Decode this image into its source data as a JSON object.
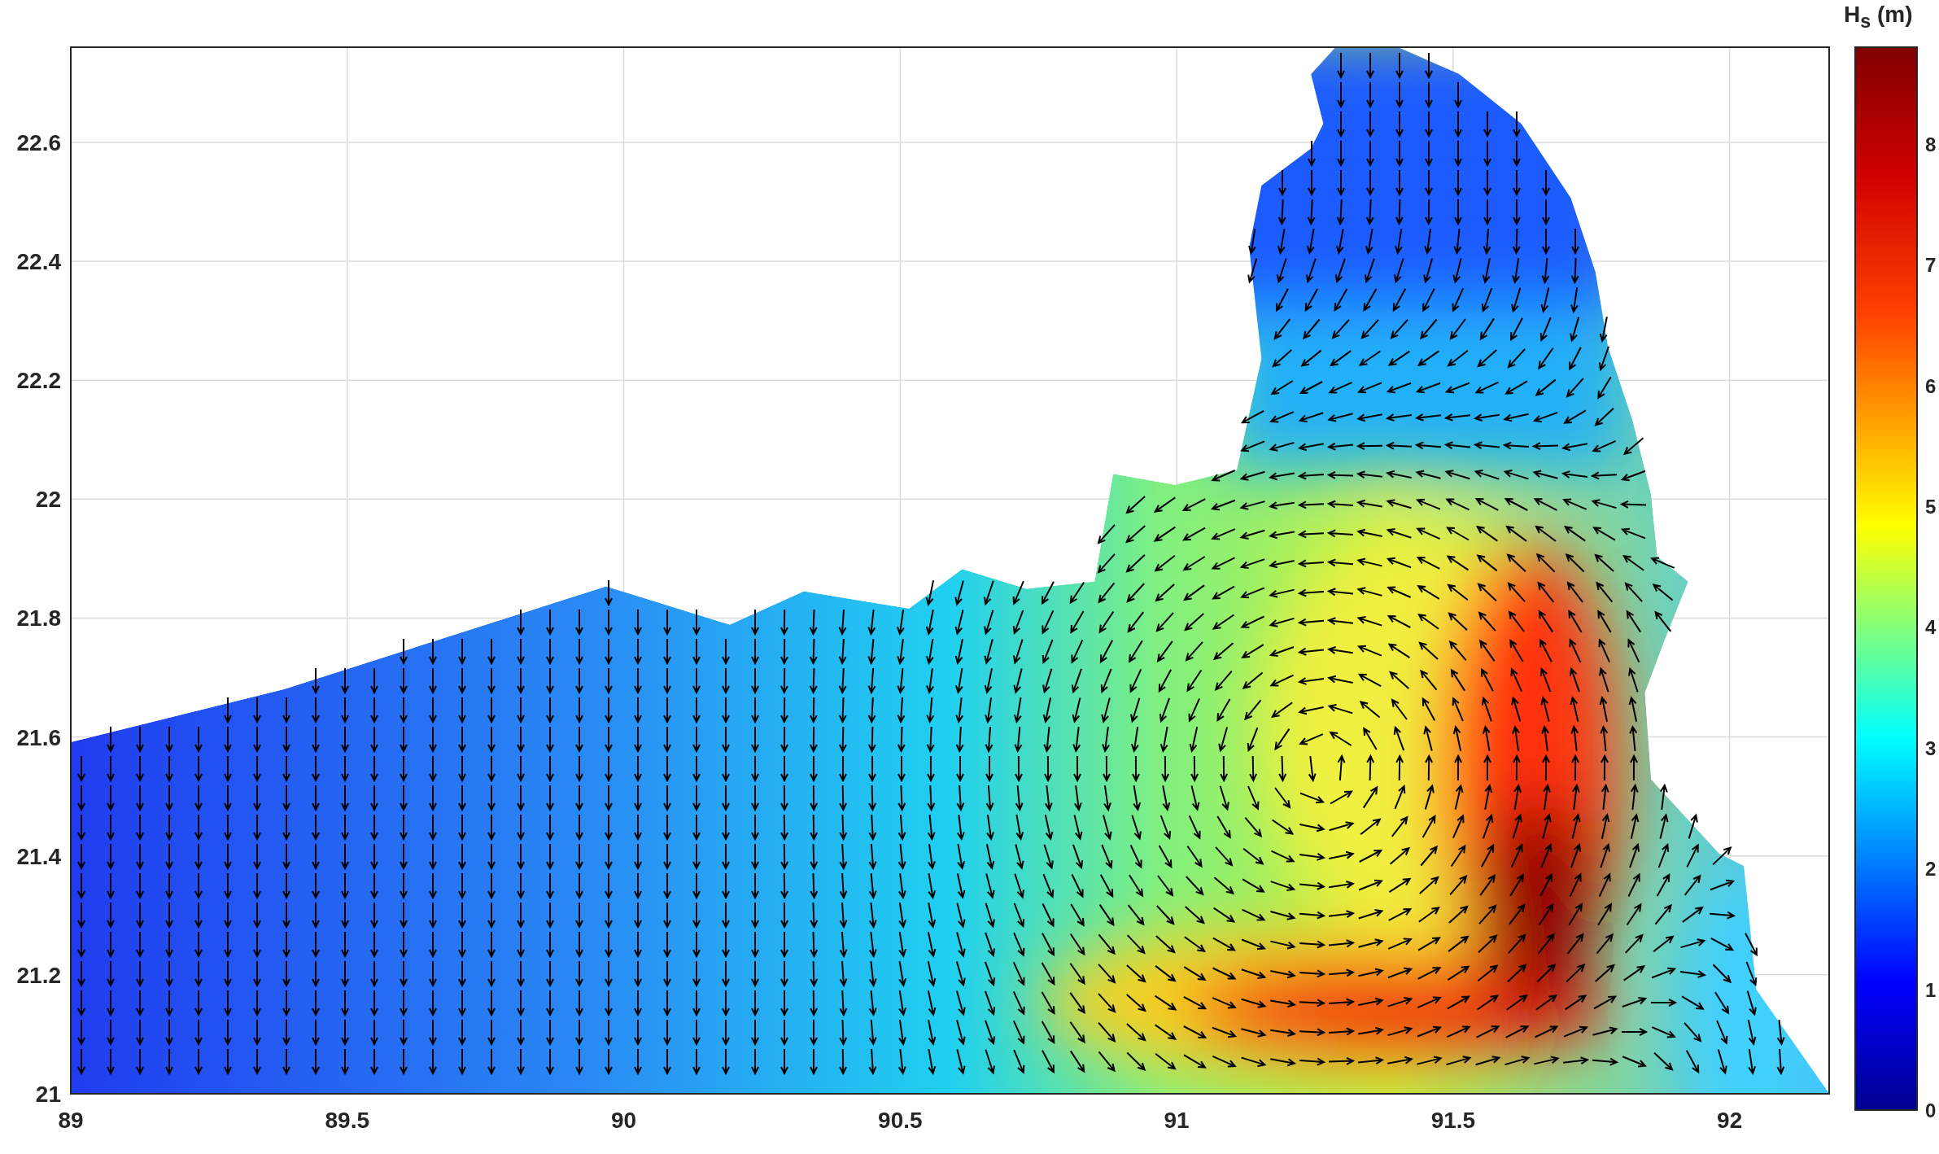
{
  "plot": {
    "x_ticks": [
      "89",
      "89.5",
      "90",
      "90.5",
      "91",
      "91.5",
      "92"
    ],
    "y_ticks": [
      "22.6",
      "22.4",
      "22.2",
      "22",
      "21.8",
      "21.6",
      "21.4",
      "21.2",
      "21"
    ],
    "colorbar": {
      "title": "H$_{s}$ (m)",
      "ticks": [
        "8",
        "7",
        "6",
        "5",
        "4",
        "3",
        "2",
        "1",
        "0"
      ]
    }
  }
}
